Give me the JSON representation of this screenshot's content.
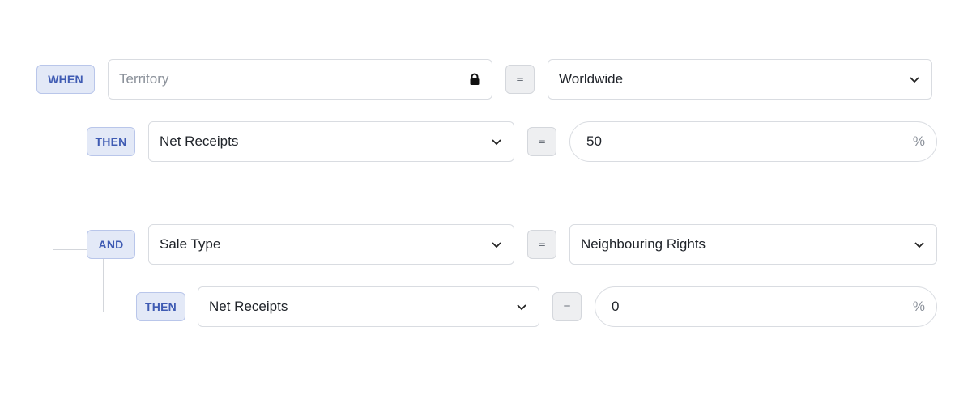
{
  "rules": {
    "when": {
      "badge": "WHEN",
      "field": {
        "placeholder": "Territory",
        "icon": "lock-icon"
      },
      "operator": "=",
      "value": {
        "label": "Worldwide",
        "icon": "chevron-down-icon"
      }
    },
    "then_1": {
      "badge": "THEN",
      "field": {
        "label": "Net Receipts",
        "icon": "chevron-down-icon"
      },
      "operator": "=",
      "value": {
        "amount": "50",
        "unit": "%"
      }
    },
    "and": {
      "badge": "AND",
      "field": {
        "label": "Sale Type",
        "icon": "chevron-down-icon"
      },
      "operator": "=",
      "value": {
        "label": "Neighbouring Rights",
        "icon": "chevron-down-icon"
      }
    },
    "then_2": {
      "badge": "THEN",
      "field": {
        "label": "Net Receipts",
        "icon": "chevron-down-icon"
      },
      "operator": "=",
      "value": {
        "amount": "0",
        "unit": "%"
      }
    }
  },
  "colors": {
    "badge_bg": "#e3e9f7",
    "badge_text": "#3f5bb3",
    "border": "#d9dce1",
    "connector": "#d3d6db"
  }
}
